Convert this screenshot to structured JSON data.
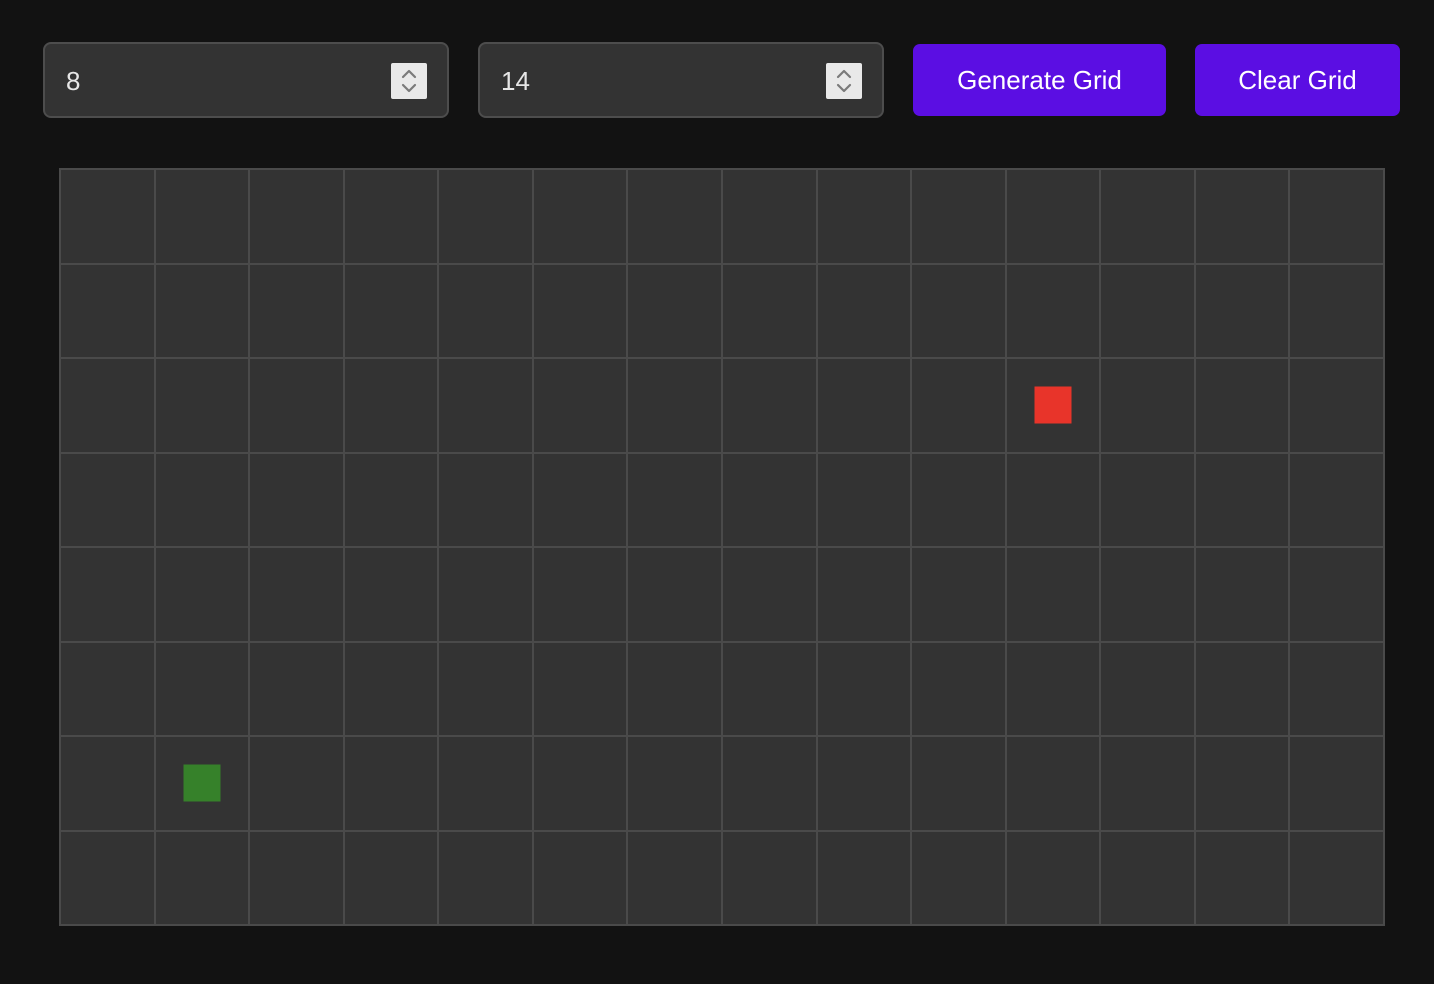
{
  "controls": {
    "rows_input": {
      "value": "8"
    },
    "cols_input": {
      "value": "14"
    },
    "generate_label": "Generate Grid",
    "clear_label": "Clear Grid"
  },
  "grid": {
    "rows": 8,
    "cols": 14,
    "markers": [
      {
        "name": "end-node",
        "row": 2,
        "col": 10,
        "color": "#e8342a"
      },
      {
        "name": "start-node",
        "row": 6,
        "col": 1,
        "color": "#36812a"
      }
    ]
  },
  "colors": {
    "accent": "#5b0ee3",
    "cell": "#333333",
    "grid_line": "#4a4a4a",
    "background": "#121212"
  }
}
